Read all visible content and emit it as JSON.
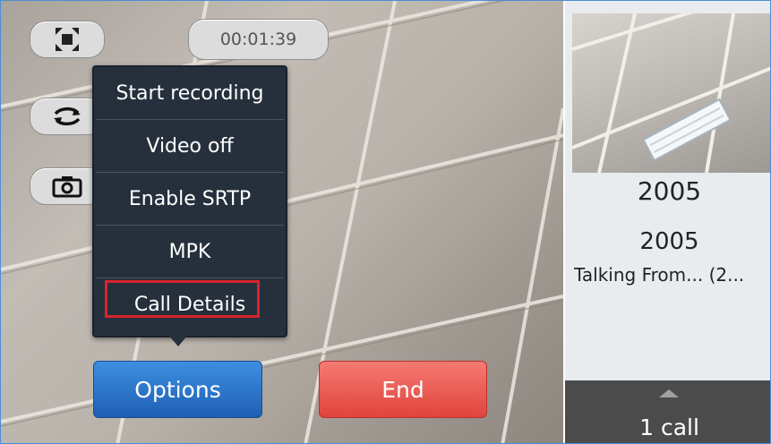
{
  "call": {
    "timer": "00:01:39",
    "controls": {
      "fullscreen_icon": "fullscreen-icon",
      "switch_icon": "switch-camera-icon",
      "snapshot_icon": "camera-icon"
    }
  },
  "options_menu": {
    "items": [
      {
        "label": "Start recording"
      },
      {
        "label": "Video off"
      },
      {
        "label": "Enable SRTP"
      },
      {
        "label": "MPK"
      },
      {
        "label": "Call Details"
      }
    ],
    "highlighted": "Call Details",
    "highlight_color": "#d9232b"
  },
  "actions": {
    "options_label": "Options",
    "end_label": "End"
  },
  "right_panel": {
    "number": "2005",
    "name": "2005",
    "status": "Talking From... (2...",
    "calls_label": "1 call"
  },
  "colors": {
    "options_button": "#2a73c9",
    "end_button": "#ea5a52",
    "menu_background": "#26303d"
  }
}
